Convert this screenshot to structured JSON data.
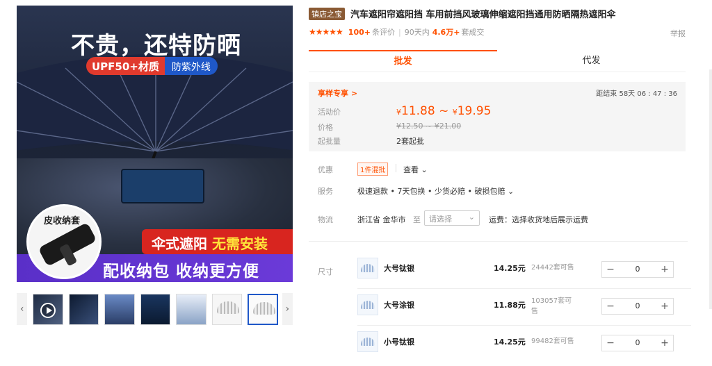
{
  "gallery": {
    "headline": "不贵，还特防晒",
    "upf_badge": "UPF50+材质",
    "uv_badge": "防紫外线",
    "circle_label": "皮收纳套",
    "ad_line1_white": "伞式遮阳",
    "ad_line1_yellow": "无需安装",
    "ad_line2": "配收纳包 收纳更方便",
    "prev_arrow": "‹",
    "next_arrow": "›"
  },
  "product": {
    "shop_badge": "镇店之宝",
    "title": "汽车遮阳帘遮阳挡 车用前挡风玻璃伸缩遮阳挡通用防晒隔热遮阳伞",
    "stars": "★★★★★",
    "review_count": "100+",
    "review_label": "条评价",
    "sold_period": "90天内",
    "sold_count": "4.6万+",
    "sold_label": "套成交",
    "report": "举报"
  },
  "tabs": [
    {
      "label": "批发",
      "active": true
    },
    {
      "label": "代发",
      "active": false
    }
  ],
  "price": {
    "promo": "享样专享 >",
    "countdown": "距结束 58天 06 : 47 : 36",
    "activity_label": "活动价",
    "currency": "¥",
    "price_low": "11.88",
    "tilde": "~",
    "price_high": "19.95",
    "orig_label": "价格",
    "orig_price": "¥12.50 ~ ¥21.00",
    "moq_label": "起批量",
    "moq": "2套起批"
  },
  "benefits": {
    "coupon_label": "优惠",
    "coupon": "1件混批",
    "see": "查看 ⌄",
    "service_label": "服务",
    "service": "极速退款 • 7天包换 • 少货必赔 • 破损包赔 ⌄",
    "logistics_label": "物流",
    "origin": "浙江省 金华市",
    "to": "至",
    "address_placeholder": "请选择",
    "freight": "运费：选择收货地后展示运费"
  },
  "sku_label": "尺寸",
  "skus": [
    {
      "name": "大号钛银",
      "price": "14.25元",
      "stock": "24442套可售",
      "qty": "0"
    },
    {
      "name": "大号涂银",
      "price": "11.88元",
      "stock": "103057套可售",
      "qty": "0"
    },
    {
      "name": "小号钛银",
      "price": "14.25元",
      "stock": "99482套可售",
      "qty": "0"
    }
  ],
  "stepper": {
    "minus": "−",
    "plus": "+"
  },
  "colors": {
    "accent": "#ff5000",
    "shop_badge": "#8a5a34",
    "selected_thumb": "#1f58c8"
  },
  "icons": {
    "thumb_prev": "chevron-left-icon",
    "thumb_next": "chevron-right-icon",
    "video": "play-icon",
    "dropdown": "chevron-down-icon"
  }
}
